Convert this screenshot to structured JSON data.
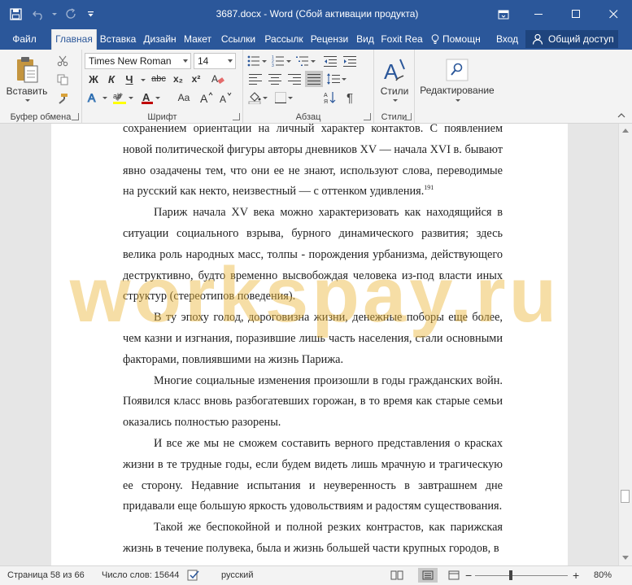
{
  "window": {
    "title": "3687.docx - Word (Сбой активации продукта)"
  },
  "tabs": [
    {
      "label": "Файл"
    },
    {
      "label": "Главная"
    },
    {
      "label": "Вставка"
    },
    {
      "label": "Дизайн"
    },
    {
      "label": "Макет"
    },
    {
      "label": "Ссылки"
    },
    {
      "label": "Рассылк"
    },
    {
      "label": "Рецензи"
    },
    {
      "label": "Вид"
    },
    {
      "label": "Foxit Rea"
    }
  ],
  "tabs_right": {
    "help": "Помощн",
    "login": "Вход",
    "share": "Общий доступ"
  },
  "ribbon": {
    "clipboard": {
      "paste_label": "Вставить",
      "group_label": "Буфер обмена"
    },
    "font": {
      "name": "Times New Roman",
      "size": "14",
      "group_label": "Шрифт",
      "bold": "Ж",
      "italic": "К",
      "underline": "Ч",
      "strike": "abc",
      "subscript": "x₂",
      "superscript": "x²"
    },
    "paragraph": {
      "group_label": "Абзац"
    },
    "styles": {
      "label": "Стили",
      "group_label": "Стили"
    },
    "editing": {
      "label": "Редактирование"
    }
  },
  "document": {
    "paragraphs": [
      {
        "text": "сохранением ориентации на личный характер контактов. С появлением новой политической фигуры авторы дневников XV — начала XVI в. бывают явно озадачены тем, что они ее не знают, используют слова, переводимые на русский как некто, неизвестный — с оттенком удивления.",
        "footnote": "191",
        "indent": false
      },
      {
        "text": "Париж начала XV века можно характеризовать как находящийся в ситуации социального взрыва, бурного динамического развития; здесь велика роль народных масс, толпы - порождения урбанизма, действующего деструктивно, будто временно высвобождая человека из-под власти иных структур (стереотипов поведения).",
        "indent": true
      },
      {
        "text": "В ту эпоху голод, дороговизна жизни, денежные поборы еще более, чем казни и изгнания, поразившие лишь часть населения, стали основными факторами, повлиявшими на жизнь Парижа.",
        "indent": true
      },
      {
        "text": "Многие социальные изменения произошли в годы гражданских войн. Появился класс вновь разбогатевших горожан, в то время как старые семьи оказались полностью разорены.",
        "indent": true
      },
      {
        "text": "И все же мы не сможем составить верного представления о красках жизни в те трудные годы, если будем видеть лишь мрачную и трагическую ее сторону. Недавние испытания и неуверенность в завтрашнем дне придавали еще большую яркость удовольствиям и радостям существования.",
        "indent": true
      },
      {
        "text": "Такой же беспокойной и полной резких контрастов, как парижская жизнь в течение полувека, была и жизнь большей части крупных городов, в",
        "indent": true
      }
    ],
    "watermark": "workspay.ru"
  },
  "statusbar": {
    "page": "Страница 58 из 66",
    "words": "Число слов: 15644",
    "language": "русский",
    "zoom_percent": 80,
    "zoom_label": "80%"
  },
  "colors": {
    "accent": "#2b579a",
    "ribbon_bg": "#f3f3f3",
    "watermark": "#ecb63a"
  }
}
